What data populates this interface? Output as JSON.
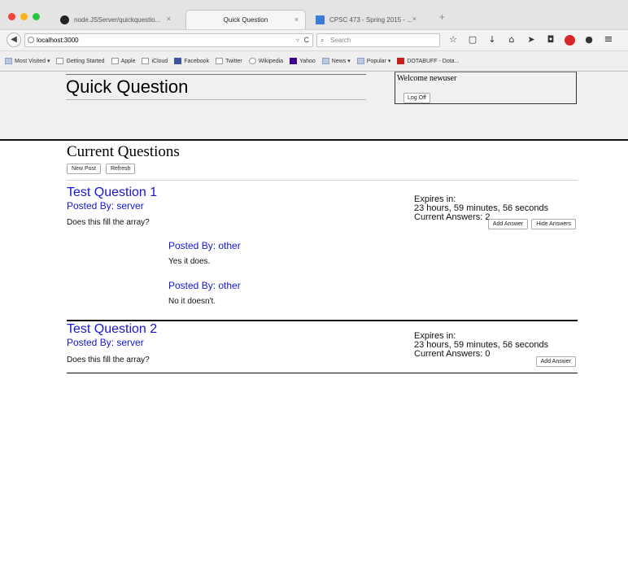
{
  "browser": {
    "tabs": [
      {
        "title": "node.JSServer/quickquestio...",
        "icon": "github-icon"
      },
      {
        "title": "Quick Question",
        "active": true
      },
      {
        "title": "CPSC 473 - Spring 2015 - ...",
        "icon": "document-icon"
      }
    ],
    "tab_close": "×",
    "new_tab": "+",
    "url": "localhost:3000",
    "search_placeholder": "Search",
    "bookmarks": [
      {
        "label": "Most Visited ▾",
        "icon": "folder-icon"
      },
      {
        "label": "Getting Started",
        "icon": "page-icon"
      },
      {
        "label": "Apple",
        "icon": "page-icon"
      },
      {
        "label": "iCloud",
        "icon": "page-icon"
      },
      {
        "label": "Facebook",
        "icon": "facebook-icon"
      },
      {
        "label": "Twitter",
        "icon": "page-icon"
      },
      {
        "label": "Wikipedia",
        "icon": "wikipedia-icon"
      },
      {
        "label": "Yahoo",
        "icon": "yahoo-icon"
      },
      {
        "label": "News ▾",
        "icon": "folder-icon"
      },
      {
        "label": "Popular ▾",
        "icon": "folder-icon"
      },
      {
        "label": "DOTABUFF - Dota...",
        "icon": "dotabuff-icon"
      }
    ]
  },
  "site": {
    "title": "Quick Question",
    "welcome": "Welcome newuser",
    "logoff_label": "Log Off"
  },
  "questions_section": {
    "heading": "Current Questions",
    "new_post_label": "New Post",
    "refresh_label": "Refresh"
  },
  "questions": [
    {
      "title": "Test Question 1",
      "posted_by": "Posted By: server",
      "body": "Does this fill the array?",
      "expires_label": "Expires in:",
      "expires_value": "23 hours, 59 minutes, 56 seconds",
      "answers_count": "Current Answers: 2",
      "add_answer_label": "Add Answer",
      "hide_answers_label": "Hide Answers",
      "answers": [
        {
          "posted_by": "Posted By: other",
          "body": "Yes it does."
        },
        {
          "posted_by": "Posted By: other",
          "body": "No it doesn't."
        }
      ]
    },
    {
      "title": "Test Question 2",
      "posted_by": "Posted By: server",
      "body": "Does this fill the array?",
      "expires_label": "Expires in:",
      "expires_value": "23 hours, 59 minutes, 56 seconds",
      "answers_count": "Current Answers: 0",
      "add_answer_label": "Add Answer"
    }
  ]
}
